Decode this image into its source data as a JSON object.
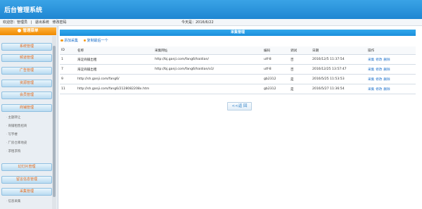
{
  "header": {
    "title": "后台管理系统"
  },
  "info_bar": {
    "welcome": "欢迎您：管理员",
    "separator": "|",
    "logout": "退出系统",
    "change_password": "修改密码",
    "today": "今天是：2016/6/22"
  },
  "sidebar": {
    "header": "管理菜单",
    "sections": [
      {
        "label": "系统管理"
      },
      {
        "label": "频道管理"
      },
      {
        "label": "广告管理"
      },
      {
        "label": "资源管理"
      },
      {
        "label": "会员管理"
      },
      {
        "label": "商铺管理",
        "items": [
          "主题转让",
          "商铺租售招商",
          "写字楼",
          "厂房仓库地皮",
          "求租求购"
        ]
      },
      {
        "label": "幻灯片管理"
      },
      {
        "label": "留言信息管理"
      },
      {
        "label": "采集管理",
        "items": [
          "信息采集"
        ]
      }
    ]
  },
  "main": {
    "title": "采集管理",
    "actions": [
      "添加采集",
      "复制最后一个"
    ],
    "table": {
      "columns": [
        "ID",
        "名称",
        "采集网址",
        "编码",
        "调试",
        "日期",
        "操作"
      ],
      "rows": [
        {
          "id": "1",
          "name": "海淀商铺出租",
          "url": "http://bj.ganji.com/fang6/haidian/",
          "encoding": "utf-8",
          "debug": "否",
          "date": "2016/12/5 11:37:54"
        },
        {
          "id": "7",
          "name": "海淀商铺出租",
          "url": "http://bj.ganji.com/fang6/haidian/o1/",
          "encoding": "utf-8",
          "debug": "否",
          "date": "2016/12/25 13:57:47"
        },
        {
          "id": "9",
          "name": "http://sh.ganji.com/fang6/",
          "url": "",
          "encoding": "gb2312",
          "debug": "是",
          "date": "2016/5/25 11:53:53"
        },
        {
          "id": "11",
          "name": "http://sh.ganji.com/fang6/2128082208x.htm",
          "url": "",
          "encoding": "gb2312",
          "debug": "是",
          "date": "2016/5/27 11:36:54"
        }
      ],
      "row_ops": [
        "采集",
        "修改",
        "删除"
      ]
    },
    "back_label": "<<返 回"
  },
  "colors": {
    "accent": "#1f86d2",
    "menu_header": "#f08a00",
    "link": "#1a6ec9",
    "menu_text": "#e2681a"
  }
}
